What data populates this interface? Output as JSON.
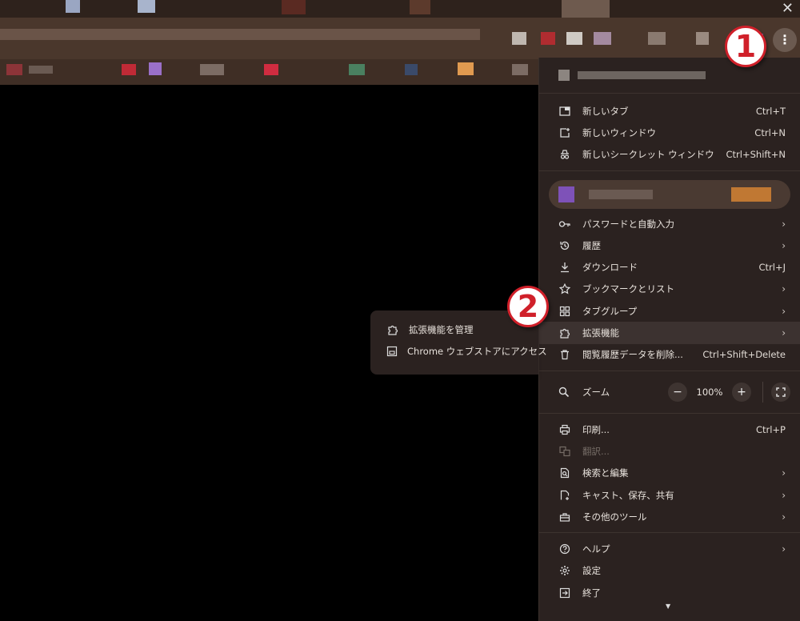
{
  "markers": {
    "step1": "1",
    "step2": "2"
  },
  "menu": {
    "group1": [
      {
        "label": "新しいタブ",
        "shortcut": "Ctrl+T",
        "icon": "new-tab-icon"
      },
      {
        "label": "新しいウィンドウ",
        "shortcut": "Ctrl+N",
        "icon": "new-window-icon"
      },
      {
        "label": "新しいシークレット ウィンドウ",
        "shortcut": "Ctrl+Shift+N",
        "icon": "incognito-icon"
      }
    ],
    "group2": [
      {
        "label": "パスワードと自動入力",
        "icon": "key-icon"
      },
      {
        "label": "履歴",
        "icon": "history-icon"
      },
      {
        "label": "ダウンロード",
        "shortcut": "Ctrl+J",
        "icon": "download-icon"
      },
      {
        "label": "ブックマークとリスト",
        "icon": "star-icon"
      },
      {
        "label": "タブグループ",
        "icon": "tab-groups-icon"
      },
      {
        "label": "拡張機能",
        "icon": "extension-icon"
      },
      {
        "label": "閲覧履歴データを削除...",
        "shortcut": "Ctrl+Shift+Delete",
        "icon": "trash-icon"
      }
    ],
    "zoom": {
      "label": "ズーム",
      "value": "100%",
      "minus": "−",
      "plus": "+"
    },
    "group3": [
      {
        "label": "印刷...",
        "shortcut": "Ctrl+P",
        "icon": "print-icon"
      },
      {
        "label": "翻訳...",
        "icon": "translate-icon"
      },
      {
        "label": "検索と編集",
        "icon": "search-edit-icon"
      },
      {
        "label": "キャスト、保存、共有",
        "icon": "cast-icon"
      },
      {
        "label": "その他のツール",
        "icon": "toolbox-icon"
      }
    ],
    "group4": [
      {
        "label": "ヘルプ",
        "icon": "help-icon"
      },
      {
        "label": "設定",
        "icon": "gear-icon"
      },
      {
        "label": "終了",
        "icon": "exit-icon"
      }
    ]
  },
  "submenu": {
    "items": [
      {
        "label": "拡張機能を管理",
        "icon": "extension-icon"
      },
      {
        "label": "Chrome ウェブストアにアクセス",
        "icon": "webstore-icon"
      }
    ]
  }
}
